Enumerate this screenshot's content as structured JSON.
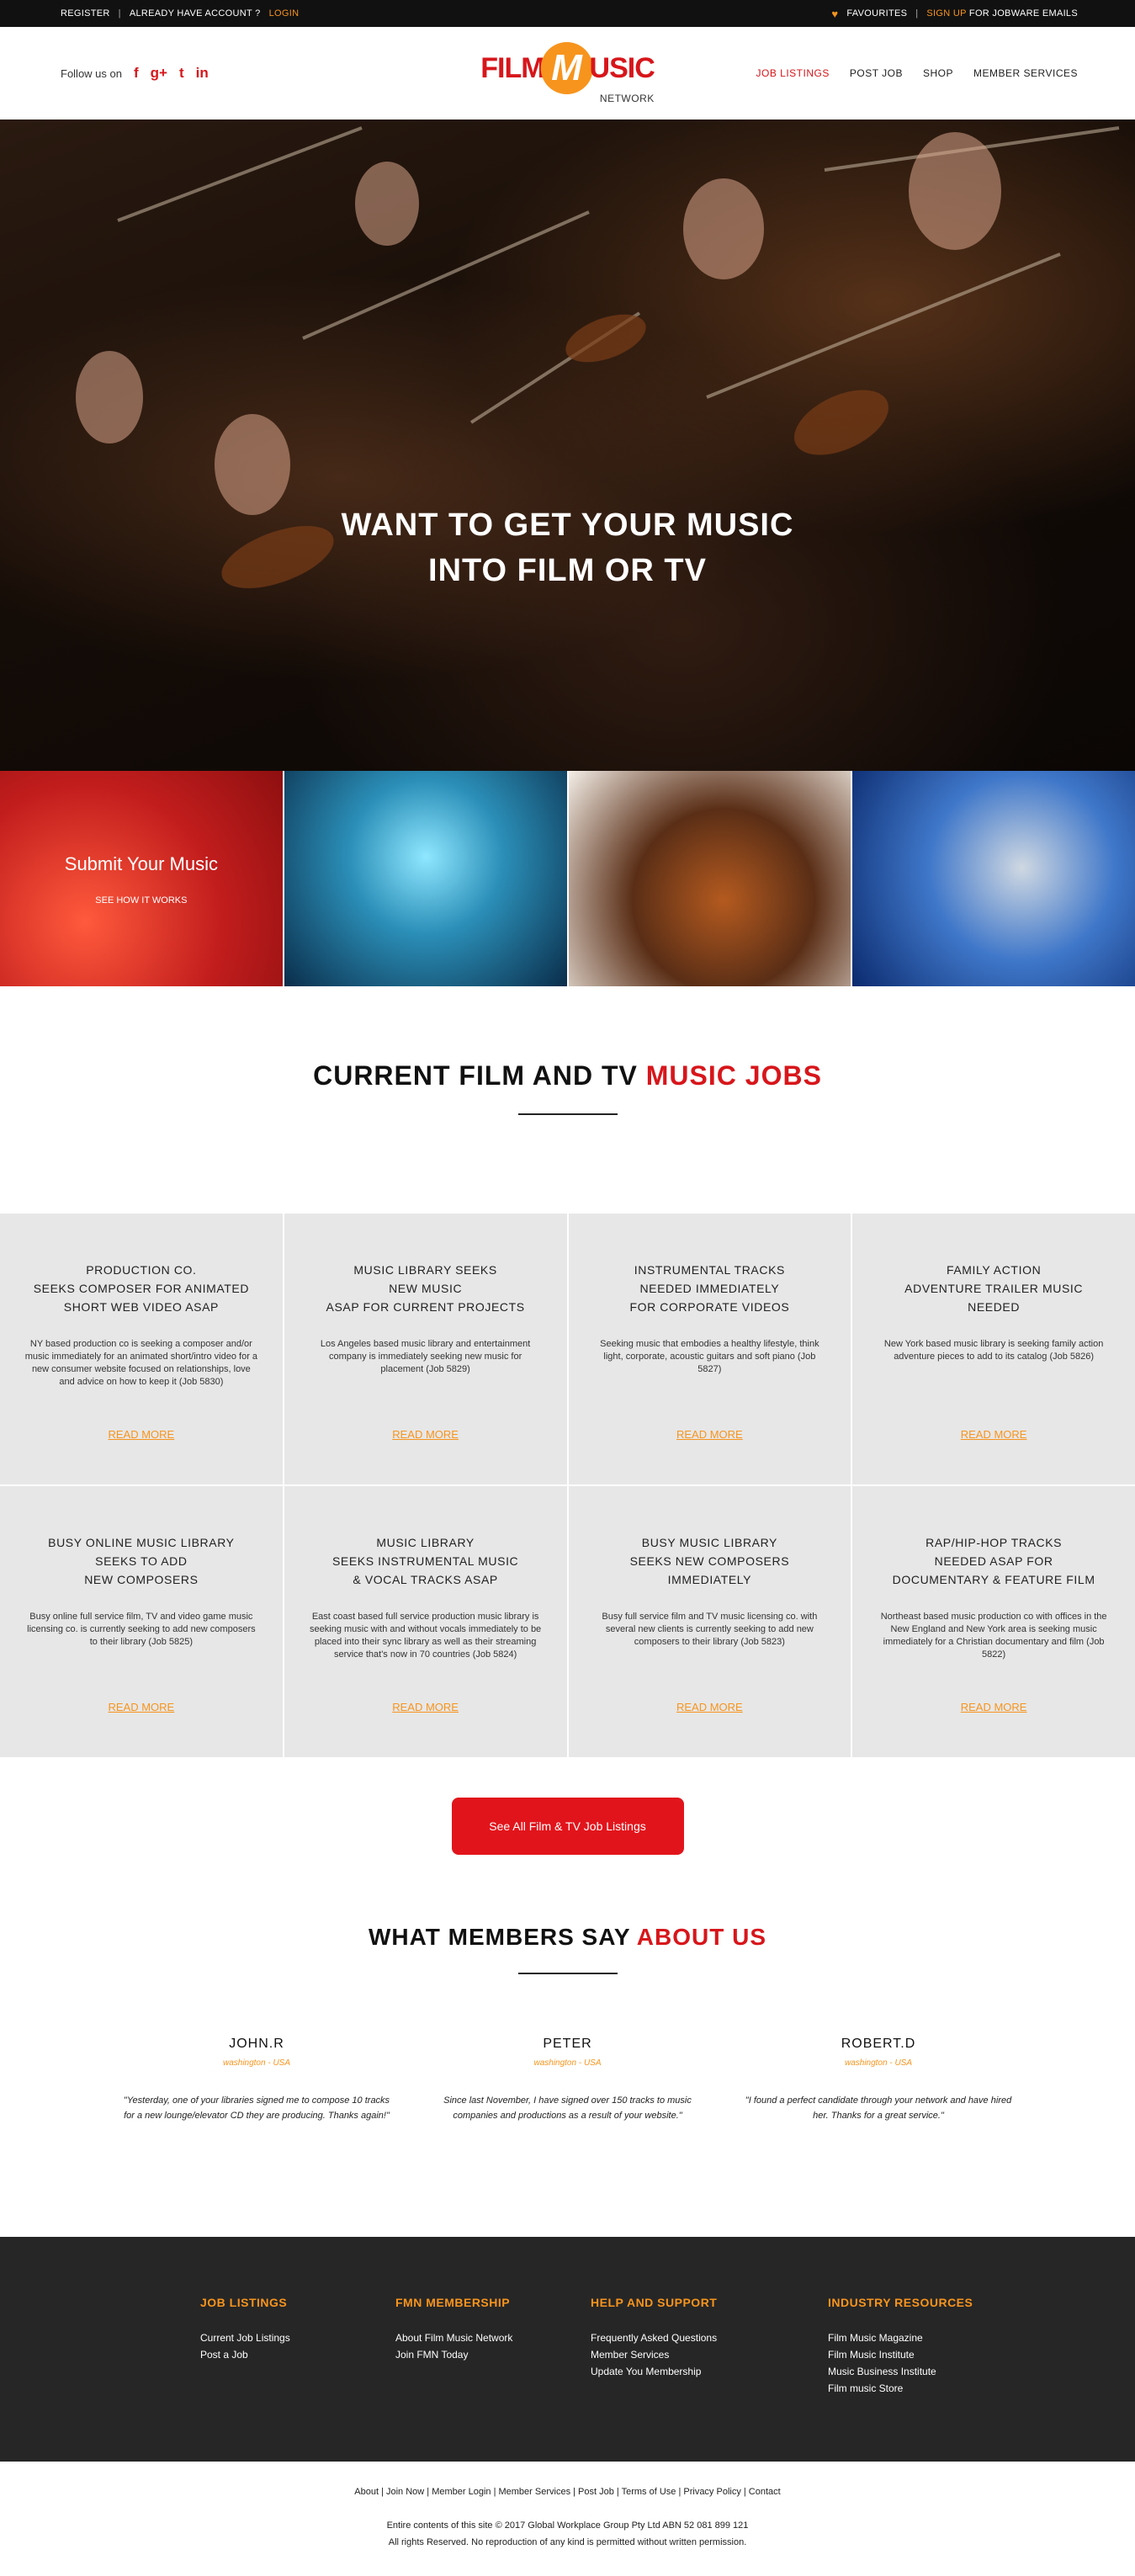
{
  "topbar": {
    "register": "REGISTER",
    "already": "ALREADY HAVE ACCOUNT ?",
    "login": "LOGIN",
    "favourites": "FAVOURITES",
    "signup": "SIGN UP",
    "signup_suffix": "FOR JOBWARE EMAILS"
  },
  "header": {
    "follow": "Follow us on",
    "social": [
      "f",
      "g+",
      "t",
      "in"
    ],
    "logo": {
      "film": "FILM",
      "m": "M",
      "music": "USIC",
      "network": "NETWORK"
    },
    "nav": [
      "JOB LISTINGS",
      "POST JOB",
      "SHOP",
      "MEMBER SERVICES"
    ]
  },
  "hero": {
    "line1": "WANT TO GET YOUR MUSIC",
    "line2": "INTO FILM OR TV"
  },
  "tiles": {
    "title": "Submit Your Music",
    "link": "SEE HOW IT WORKS"
  },
  "jobs": {
    "title_a": "CURRENT FILM AND TV",
    "title_b": "MUSIC JOBS",
    "read_more": "READ MORE",
    "items": [
      {
        "title": "PRODUCTION CO.\nSEEKS COMPOSER FOR ANIMATED\nSHORT WEB VIDEO ASAP",
        "desc": "NY based production co is seeking a composer and/or music immediately for an animated short/intro video for a new consumer website focused on relationships, love and advice on how to keep it (Job 5830)"
      },
      {
        "title": "MUSIC LIBRARY SEEKS\nNEW MUSIC\nASAP FOR CURRENT PROJECTS",
        "desc": "Los Angeles based music library and entertainment company is immediately seeking new music for placement (Job 5829)"
      },
      {
        "title": "INSTRUMENTAL TRACKS\nNEEDED IMMEDIATELY\nFOR CORPORATE VIDEOS",
        "desc": "Seeking music that embodies a healthy lifestyle, think light, corporate, acoustic guitars and soft piano (Job 5827)"
      },
      {
        "title": "FAMILY ACTION\nADVENTURE TRAILER MUSIC\nNEEDED",
        "desc": "New York based music library is seeking family action adventure pieces to add to its catalog (Job 5826)"
      },
      {
        "title": "BUSY ONLINE MUSIC LIBRARY\nSEEKS TO ADD\nNEW COMPOSERS",
        "desc": "Busy online full service film, TV and video game music licensing co. is currently seeking to add new composers to their library (Job 5825)"
      },
      {
        "title": "MUSIC LIBRARY\nSEEKS INSTRUMENTAL MUSIC\n& VOCAL TRACKS ASAP",
        "desc": "East coast based full service production music library is seeking music with and without vocals immediately to be placed into their sync library as well as their streaming service that's now in 70 countries (Job 5824)"
      },
      {
        "title": "BUSY MUSIC LIBRARY\nSEEKS NEW COMPOSERS\nIMMEDIATELY",
        "desc": "Busy full service film and TV music licensing co. with several new clients is currently seeking to add new composers to their library (Job 5823)"
      },
      {
        "title": "RAP/HIP-HOP TRACKS\nNEEDED ASAP FOR\nDOCUMENTARY & FEATURE FILM",
        "desc": "Northeast based music production co with offices in the New England and New York area is seeking music immediately for a Christian documentary and film (Job 5822)"
      }
    ],
    "cta": "See All Film & TV Job Listings"
  },
  "testimonials": {
    "title_a": "WHAT MEMBERS SAY",
    "title_b": "ABOUT US",
    "items": [
      {
        "name": "JOHN.R",
        "location": "washington - USA",
        "quote": "\"Yesterday, one of your libraries signed me to compose 10 tracks for a new lounge/elevator CD they are producing. Thanks again!\""
      },
      {
        "name": "PETER",
        "location": "washington - USA",
        "quote": "Since last November, I have signed over 150 tracks to music companies and productions as a result of your website.\""
      },
      {
        "name": "ROBERT.D",
        "location": "washington - USA",
        "quote": "\"I found a perfect candidate through your network and have hired her. Thanks for a great service.\""
      }
    ]
  },
  "footer": {
    "cols": [
      {
        "title": "JOB LISTINGS",
        "links": [
          "Current Job Listings",
          "Post a Job"
        ]
      },
      {
        "title": "FMN MEMBERSHIP",
        "links": [
          "About Film Music Network",
          "Join FMN Today"
        ]
      },
      {
        "title": "HELP AND SUPPORT",
        "links": [
          "Frequently Asked Questions",
          "Member Services",
          "Update You Membership"
        ]
      },
      {
        "title": "INDUSTRY RESOURCES",
        "links": [
          "Film Music Magazine",
          "Film Music Institute",
          "Music Business Institute",
          "Film music Store"
        ]
      }
    ],
    "bottom_links": "About | Join Now | Member Login | Member Services | Post Job | Terms of Use | Privacy Policy | Contact",
    "copy1": "Entire contents of this site © 2017 Global Workplace Group Pty Ltd ABN 52 081 899 121",
    "copy2": "All rights Reserved. No reproduction of any kind is permitted without written permission."
  }
}
